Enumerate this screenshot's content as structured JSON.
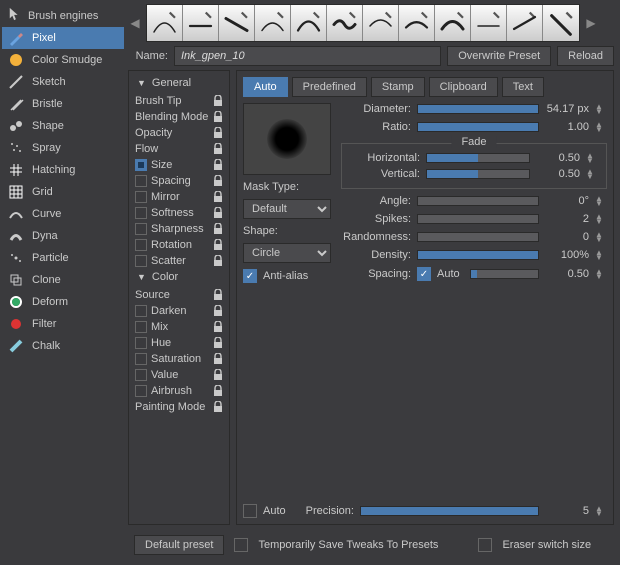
{
  "sidebar": {
    "title": "Brush engines",
    "engines": [
      {
        "label": "Pixel",
        "icon": "brush",
        "selected": true
      },
      {
        "label": "Color Smudge",
        "icon": "smudge"
      },
      {
        "label": "Sketch",
        "icon": "sketch"
      },
      {
        "label": "Bristle",
        "icon": "bristle"
      },
      {
        "label": "Shape",
        "icon": "shape"
      },
      {
        "label": "Spray",
        "icon": "spray"
      },
      {
        "label": "Hatching",
        "icon": "hatching"
      },
      {
        "label": "Grid",
        "icon": "grid"
      },
      {
        "label": "Curve",
        "icon": "curve"
      },
      {
        "label": "Dyna",
        "icon": "dyna"
      },
      {
        "label": "Particle",
        "icon": "particle"
      },
      {
        "label": "Clone",
        "icon": "clone"
      },
      {
        "label": "Deform",
        "icon": "deform"
      },
      {
        "label": "Filter",
        "icon": "filter"
      },
      {
        "label": "Chalk",
        "icon": "chalk"
      }
    ]
  },
  "name_row": {
    "label": "Name:",
    "value": "Ink_gpen_10",
    "overwrite": "Overwrite Preset",
    "reload": "Reload"
  },
  "props": {
    "group1": "General",
    "group2": "Color",
    "items1": [
      {
        "label": "Brush Tip",
        "checkbox": false
      },
      {
        "label": "Blending Mode",
        "checkbox": false
      },
      {
        "label": "Opacity",
        "checkbox": false
      },
      {
        "label": "Flow",
        "checkbox": false
      },
      {
        "label": "Size",
        "checkbox": true,
        "checked": true
      },
      {
        "label": "Spacing",
        "checkbox": true
      },
      {
        "label": "Mirror",
        "checkbox": true
      },
      {
        "label": "Softness",
        "checkbox": true
      },
      {
        "label": "Sharpness",
        "checkbox": true
      },
      {
        "label": "Rotation",
        "checkbox": true
      },
      {
        "label": "Scatter",
        "checkbox": true
      }
    ],
    "items2": [
      {
        "label": "Source",
        "checkbox": false
      },
      {
        "label": "Darken",
        "checkbox": true
      },
      {
        "label": "Mix",
        "checkbox": true
      },
      {
        "label": "Hue",
        "checkbox": true
      },
      {
        "label": "Saturation",
        "checkbox": true
      },
      {
        "label": "Value",
        "checkbox": true
      },
      {
        "label": "Airbrush",
        "checkbox": true
      }
    ],
    "footer": "Painting Mode"
  },
  "tabs": [
    "Auto",
    "Predefined",
    "Stamp",
    "Clipboard",
    "Text"
  ],
  "active_tab": "Auto",
  "mask": {
    "type_label": "Mask Type:",
    "type_value": "Default",
    "shape_label": "Shape:",
    "shape_value": "Circle",
    "aa": "Anti-alias"
  },
  "sliders": {
    "diameter": {
      "label": "Diameter:",
      "value": "54.17 px",
      "fill": 100
    },
    "ratio": {
      "label": "Ratio:",
      "value": "1.00",
      "fill": 100
    },
    "fade_title": "Fade",
    "hfade": {
      "label": "Horizontal:",
      "value": "0.50",
      "fill": 50
    },
    "vfade": {
      "label": "Vertical:",
      "value": "0.50",
      "fill": 50
    },
    "angle": {
      "label": "Angle:",
      "value": "0°",
      "fill": 0
    },
    "spikes": {
      "label": "Spikes:",
      "value": "2",
      "fill": 0
    },
    "random": {
      "label": "Randomness:",
      "value": "0",
      "fill": 0
    },
    "density": {
      "label": "Density:",
      "value": "100%",
      "fill": 100
    },
    "spacing": {
      "label": "Spacing:",
      "auto": "Auto",
      "value": "0.50",
      "fill": 10
    }
  },
  "precision": {
    "auto": "Auto",
    "label": "Precision:",
    "value": "5",
    "fill": 100
  },
  "footer": {
    "default_preset": "Default preset",
    "temp_save": "Temporarily Save Tweaks To Presets",
    "eraser": "Eraser switch size"
  }
}
